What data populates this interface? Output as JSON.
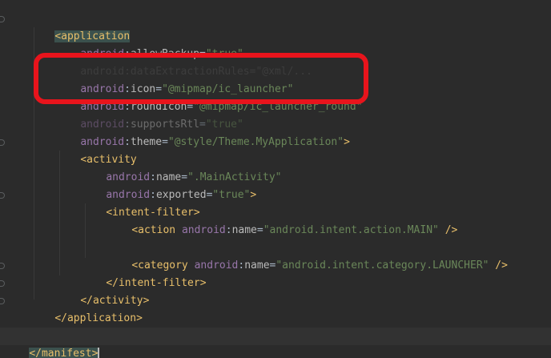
{
  "code": {
    "app_open_tag": "application",
    "allow_backup_ns": "android",
    "allow_backup_attr": "allowBackup",
    "allow_backup_val": "\"true\"",
    "hidden_line": "android:dataExtractionRules=\"@xml/...",
    "icon_ns": "android",
    "icon_attr": "icon",
    "icon_val": "\"@mipmap/ic_launcher\"",
    "round_icon_ns": "android",
    "round_icon_attr": "roundIcon",
    "round_icon_val": "\"@mipmap/ic_launcher_round\"",
    "supports_rtl_ns": "android",
    "supports_rtl_attr": "supportsRtl",
    "supports_rtl_val": "\"true\"",
    "theme_ns": "android",
    "theme_attr": "theme",
    "theme_val": "\"@style/Theme.MyApplication\"",
    "activity_tag": "activity",
    "name_ns": "android",
    "name_attr": "name",
    "name_val": "\".MainActivity\"",
    "exported_ns": "android",
    "exported_attr": "exported",
    "exported_val": "\"true\"",
    "intent_filter_tag": "intent-filter",
    "action_tag": "action",
    "action_ns": "android",
    "action_attr": "name",
    "action_val": "\"android.intent.action.MAIN\"",
    "category_tag": "category",
    "category_ns": "android",
    "category_attr": "name",
    "category_val": "\"android.intent.category.LAUNCHER\"",
    "intent_filter_close": "intent-filter",
    "activity_close": "activity",
    "application_close": "application",
    "manifest_close": "manifest"
  },
  "colors": {
    "background": "#2b2b2b",
    "tag": "#e8bf6a",
    "namespace": "#9876aa",
    "attribute": "#bababa",
    "value": "#6a8759",
    "highlight_box": "#e8141c"
  }
}
